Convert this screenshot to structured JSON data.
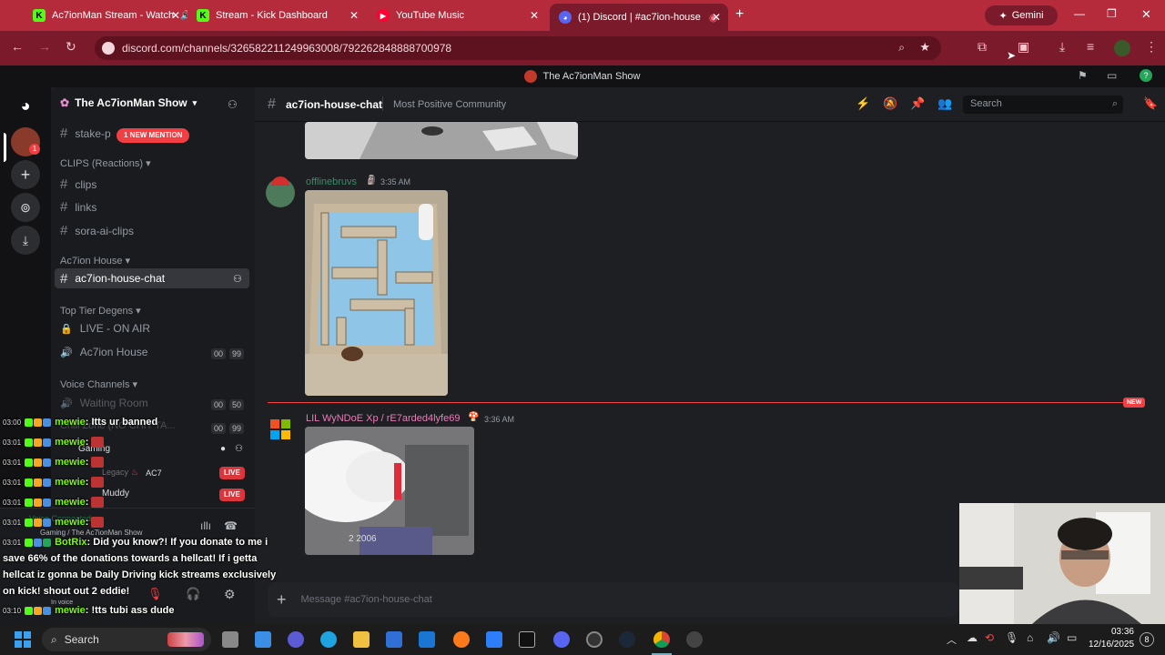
{
  "browser": {
    "tabs": [
      {
        "label": "Ac7ionMan Stream - Watch",
        "icon": "kick-icon"
      },
      {
        "label": "Stream - Kick Dashboard",
        "icon": "kick-icon"
      },
      {
        "label": "YouTube Music",
        "icon": "youtube-music-icon"
      },
      {
        "label": "(1) Discord | #ac7ion-house",
        "icon": "discord-icon"
      }
    ],
    "gemini_label": "Gemini",
    "url": "discord.com/channels/326582211249963008/792262848888700978"
  },
  "discord": {
    "window_title": "The Ac7ionMan Show",
    "server_name": "The Ac7ionMan Show",
    "mention_pill": "1 NEW MENTION",
    "channels": {
      "stake": "stake-p",
      "cat_clips": "CLIPS (Reactions)",
      "clips": "clips",
      "links": "links",
      "sora": "sora-ai-clips",
      "cat_house": "Ac7ion House",
      "house_chat": "ac7ion-house-chat",
      "cat_degens": "Top Tier Degens",
      "live_on_air": "LIVE - ON AIR",
      "ac7ion_house_voice": "Ac7ion House",
      "ac7ion_house_count_a": "00",
      "ac7ion_house_count_b": "99",
      "cat_voice": "Voice Channels",
      "waiting_room": "Waiting Room",
      "waiting_count_a": "00",
      "waiting_count_b": "50",
      "chill_zone": "Chill Zone (NO CHIT TA...",
      "chill_count_a": "00",
      "chill_count_b": "99",
      "gaming": "Gaming",
      "user_legacy": "Legacy",
      "user_ac7": "AC7",
      "user_muddy": "Muddy",
      "live_badge": "LIVE",
      "voice_connected": "Voice Connected",
      "voice_sub": "Gaming / The Ac7ionMan Show",
      "in_voice": "In voice"
    },
    "channel_header": {
      "name": "ac7ion-house-chat",
      "topic": "Most Positive Community",
      "search_placeholder": "Search"
    },
    "messages": [
      {
        "author": "offlinebruvs",
        "time": "3:35 AM"
      },
      {
        "author": "LIL WyNDoE Xp / rE7arded4lyfe69",
        "time": "3:36 AM",
        "video_overlay": "2 2006"
      }
    ],
    "new_label": "NEW",
    "composer_placeholder": "Message #ac7ion-house-chat"
  },
  "chat_overlay": [
    {
      "time": "03:00",
      "user": "mewie",
      "text": ": Itts ur banned"
    },
    {
      "time": "03:01",
      "user": "mewie",
      "text": ":"
    },
    {
      "time": "03:01",
      "user": "mewie",
      "text": ":"
    },
    {
      "time": "03:01",
      "user": "mewie",
      "text": ":"
    },
    {
      "time": "03:01",
      "user": "mewie",
      "text": ":"
    },
    {
      "time": "03:01",
      "user": "mewie",
      "text": ":"
    },
    {
      "time": "03:01",
      "user": "BotRix",
      "text": ": Did you know?! If you donate to me i"
    },
    {
      "time": "",
      "user": "",
      "text": "save 66% of the donations towards a hellcat! If i getta"
    },
    {
      "time": "",
      "user": "",
      "text": "hellcat iz gonna be Daily Driving kick streams exclusively"
    },
    {
      "time": "",
      "user": "",
      "text": "on kick! shout out 2 eddie!"
    },
    {
      "time": "03:10",
      "user": "mewie",
      "text": ": !tts tubi ass dude"
    }
  ],
  "taskbar": {
    "search_label": "Search",
    "time": "03:36",
    "date": "12/16/2025",
    "notif_count": "8"
  }
}
